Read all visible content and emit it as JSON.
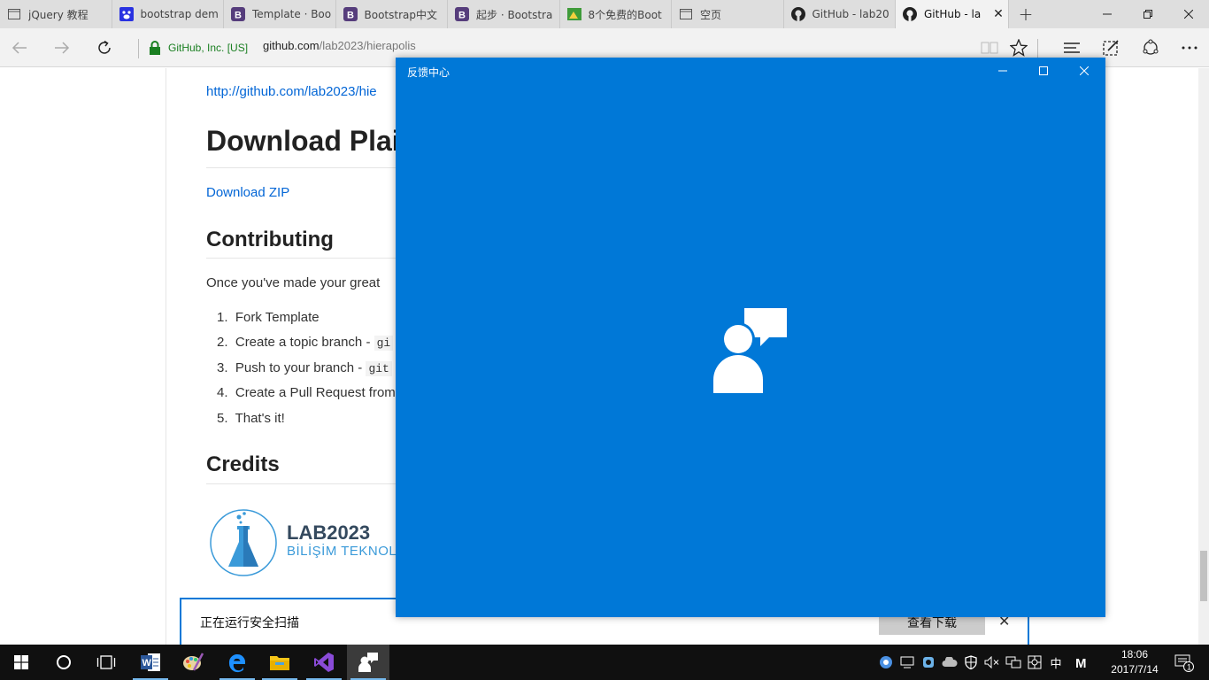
{
  "browser": {
    "tabs": [
      {
        "label": "jQuery 教程"
      },
      {
        "label": "bootstrap dem"
      },
      {
        "label": "Template · Boo"
      },
      {
        "label": "Bootstrap中文"
      },
      {
        "label": "起步 · Bootstra"
      },
      {
        "label": "8个免费的Boot"
      },
      {
        "label": "空页"
      },
      {
        "label": "GitHub - lab20"
      },
      {
        "label": "GitHub - la",
        "active": true
      }
    ],
    "cert_label": "GitHub, Inc. [US]",
    "url_host": "github.com",
    "url_path": "/lab2023/hierapolis"
  },
  "page": {
    "top_link": "http://github.com/lab2023/hie",
    "heading_download": "Download Plai",
    "download_zip": "Download ZIP",
    "heading_contributing": "Contributing",
    "contrib_text": "Once you've made your great",
    "steps": [
      {
        "text": "Fork Template",
        "code": ""
      },
      {
        "text": "Create a topic branch - ",
        "code": "gi"
      },
      {
        "text": "Push to your branch - ",
        "code": "git"
      },
      {
        "text": "Create a Pull Request from",
        "code": ""
      },
      {
        "text": "That's it!",
        "code": ""
      }
    ],
    "heading_credits": "Credits",
    "logo_title": "LAB2023",
    "logo_subtitle": "BİLİŞİM TEKNOL"
  },
  "download_bar": {
    "message": "正在运行安全扫描",
    "view_downloads": "查看下载",
    "close": "✕"
  },
  "feedback_window": {
    "title": "反馈中心",
    "accent": "#0078d7"
  },
  "taskbar": {
    "time": "18:06",
    "date": "2017/7/14",
    "ime_label": "中",
    "notification_count": "1"
  }
}
